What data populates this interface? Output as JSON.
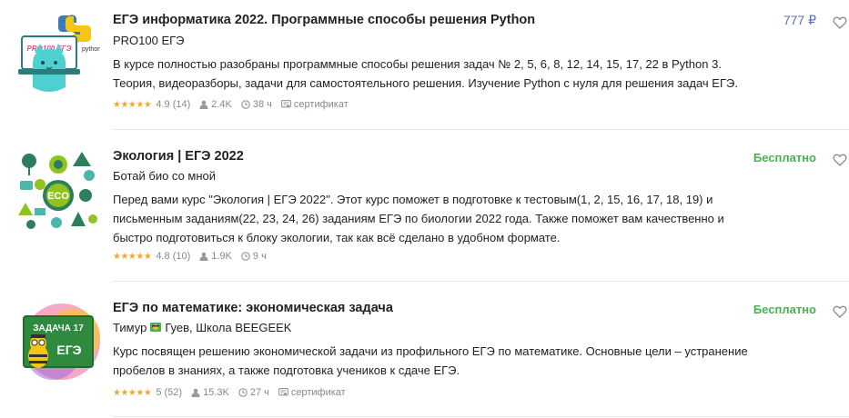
{
  "courses": [
    {
      "title": "ЕГЭ информатика 2022. Программные способы решения Python",
      "author": "PRO100 ЕГЭ",
      "description": "В курсе полностью разобраны программные способы решения задач № 2, 5, 6, 8, 12, 14, 15, 17, 22 в Python 3. Теория, видеоразборы, задачи для самостоятельного решения. Изучение Python с нуля для решения задач ЕГЭ.",
      "rating": "4.9",
      "reviews": "(14)",
      "learners": "2.4K",
      "duration": "38 ч",
      "certificate": "сертификат",
      "price": "777 ₽",
      "thumb_text": "PRO100 ЕГЭ",
      "thumb_badge": "python"
    },
    {
      "title": "Экология | ЕГЭ 2022",
      "author": "Ботай био со мной",
      "description": "Перед вами курс \"Экология | ЕГЭ 2022\". Этот курс поможет в подготовке к тестовым(1, 2, 15, 16, 17, 18, 19) и письменным заданиям(22, 23, 24, 26) заданиям ЕГЭ по биологии 2022 года. Также поможет вам качественно и быстро подготовиться к блоку экологии, так как всё сделано в удобном формате.",
      "rating": "4.8",
      "reviews": "(10)",
      "learners": "1.9K",
      "duration": "9 ч",
      "price": "Бесплатно",
      "thumb_text": "ECO"
    },
    {
      "title": "ЕГЭ по математике: экономическая задача",
      "author_first": "Тимур",
      "author_rest": "Гуев, Школа BEEGEEK",
      "description": "Курс посвящен решению экономической задачи из профильного ЕГЭ по математике. Основные цели – устранение пробелов в знаниях, а также подготовка учеников к сдаче ЕГЭ.",
      "rating": "5",
      "reviews": "(52)",
      "learners": "15.3K",
      "duration": "27 ч",
      "certificate": "сертификат",
      "price": "Бесплатно",
      "thumb_line1": "ЗАДАЧА 17",
      "thumb_line2": "ЕГЭ"
    }
  ],
  "stars": "★★★★★",
  "colors": {
    "paid": "#5c6bc0",
    "free": "#4caf50",
    "stars": "#f0a92c",
    "muted": "#888888"
  }
}
